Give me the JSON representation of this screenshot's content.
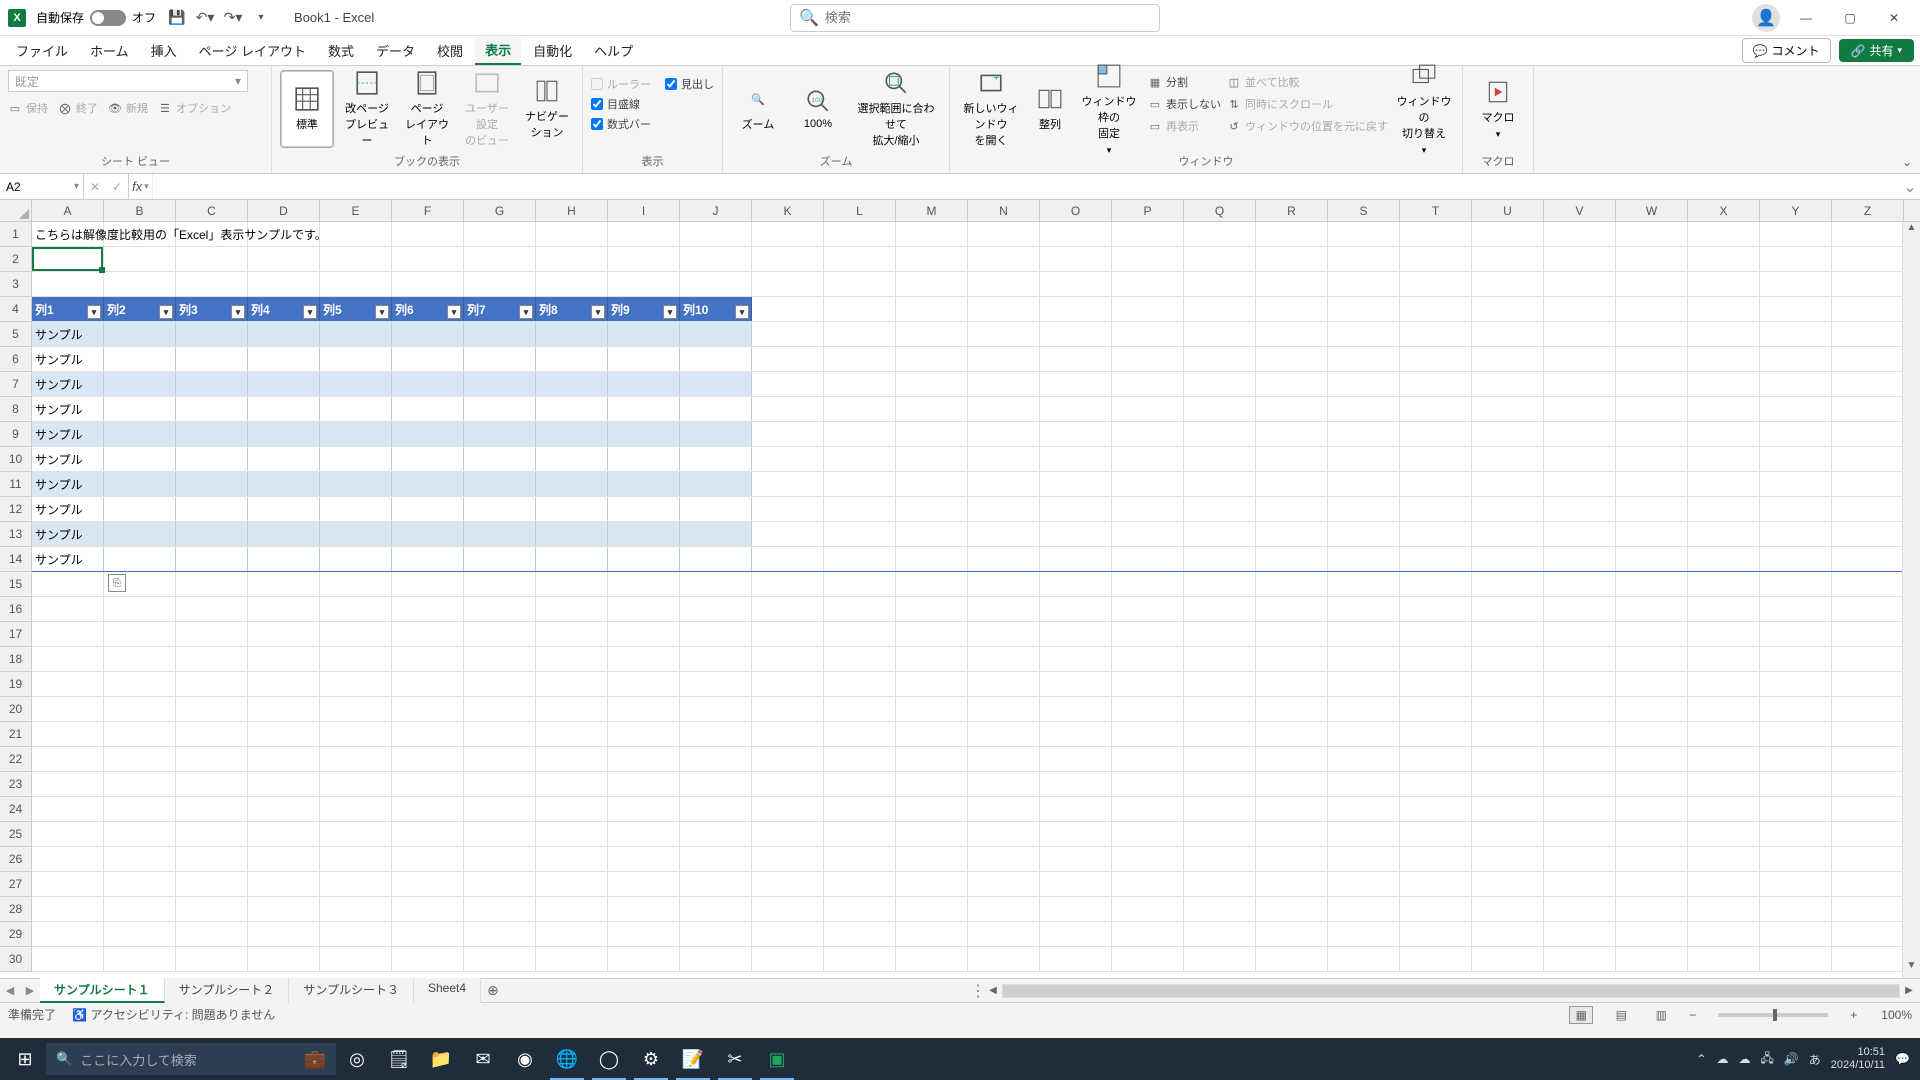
{
  "titlebar": {
    "autosave_label": "自動保存",
    "autosave_state": "オフ",
    "doc_title": "Book1 - Excel",
    "search_placeholder": "検索"
  },
  "ribbon_tabs": {
    "file": "ファイル",
    "home": "ホーム",
    "insert": "挿入",
    "page_layout": "ページ レイアウト",
    "formulas": "数式",
    "data": "データ",
    "review": "校閲",
    "view": "表示",
    "automate": "自動化",
    "help": "ヘルプ",
    "comment": "コメント",
    "share": "共有"
  },
  "ribbon": {
    "sheetview": {
      "combo": "既定",
      "keep": "保持",
      "exit": "終了",
      "new": "新規",
      "options": "オプション",
      "group": "シート ビュー"
    },
    "workbook_views": {
      "normal": "標準",
      "page_break": "改ページ\nプレビュー",
      "page_layout": "ページ\nレイアウト",
      "custom": "ユーザー設定\nのビュー",
      "navigation": "ナビゲー\nション",
      "group": "ブックの表示"
    },
    "show": {
      "ruler": "ルーラー",
      "gridlines": "目盛線",
      "formula_bar": "数式バー",
      "headings": "見出し",
      "group": "表示"
    },
    "zoom": {
      "zoom": "ズーム",
      "hundred": "100%",
      "selection": "選択範囲に合わせて\n拡大/縮小",
      "group": "ズーム"
    },
    "window": {
      "new_window": "新しいウィンドウ\nを開く",
      "arrange": "整列",
      "freeze": "ウィンドウ枠の\n固定",
      "split": "分割",
      "hide": "表示しない",
      "unhide": "再表示",
      "side_by_side": "並べて比較",
      "sync_scroll": "同時にスクロール",
      "reset_pos": "ウィンドウの位置を元に戻す",
      "switch": "ウィンドウの\n切り替え",
      "group": "ウィンドウ"
    },
    "macros": {
      "macros": "マクロ",
      "group": "マクロ"
    }
  },
  "namebox": {
    "value": "A2"
  },
  "columns": [
    "A",
    "B",
    "C",
    "D",
    "E",
    "F",
    "G",
    "H",
    "I",
    "J",
    "K",
    "L",
    "M",
    "N",
    "O",
    "P",
    "Q",
    "R",
    "S",
    "T",
    "U",
    "V",
    "W",
    "X",
    "Y",
    "Z"
  ],
  "col_widths": {
    "default": 72,
    "A": 72
  },
  "row_heights": {
    "default": 25,
    "header": 22
  },
  "cells": {
    "A1": "こちらは解像度比較用の「Excel」表示サンプルです。",
    "table_headers": [
      "列1",
      "列2",
      "列3",
      "列4",
      "列5",
      "列6",
      "列7",
      "列8",
      "列9",
      "列10"
    ],
    "sample": "サンプル"
  },
  "sheet_tabs": {
    "tabs": [
      "サンプルシート１",
      "サンプルシート２",
      "サンプルシート３",
      "Sheet4"
    ],
    "active": 0
  },
  "status": {
    "ready": "準備完了",
    "accessibility": "アクセシビリティ: 問題ありません",
    "zoom": "100%"
  },
  "taskbar": {
    "search_placeholder": "ここに入力して検索",
    "ime": "あ",
    "time": "10:51",
    "date": "2024/10/11"
  }
}
